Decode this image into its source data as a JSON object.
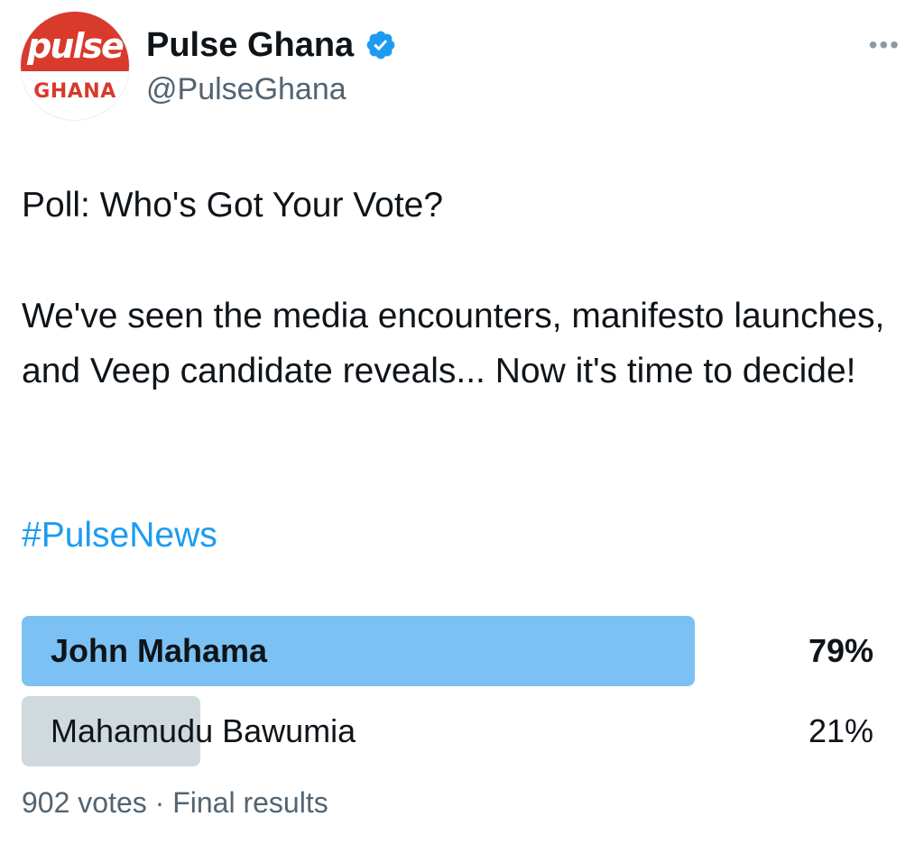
{
  "account": {
    "display_name": "Pulse Ghana",
    "handle": "@PulseGhana",
    "avatar_logo_text": "pulse",
    "avatar_sub_text": "GHANA",
    "verified_icon": "verified-badge-icon",
    "brand_color": "#d83a2c"
  },
  "tweet": {
    "line1": "Poll: Who's Got Your Vote?",
    "paragraph": "We've seen the media encounters, manifesto launches, and Veep candidate reveals... Now it's time to decide!",
    "hashtag": "#PulseNews"
  },
  "poll": {
    "options": [
      {
        "label": "John Mahama",
        "percent_text": "79%",
        "percent": 79,
        "winner": true
      },
      {
        "label": "Mahamudu Bawumia",
        "percent_text": "21%",
        "percent": 21,
        "winner": false
      }
    ],
    "votes": "902 votes",
    "separator": "·",
    "status": "Final results"
  },
  "colors": {
    "link": "#1d9bf0",
    "winner_bar": "#7cc1f4",
    "loser_bar": "#cfd9de",
    "muted_text": "#536471"
  },
  "icons": {
    "more": "more-options-icon"
  }
}
